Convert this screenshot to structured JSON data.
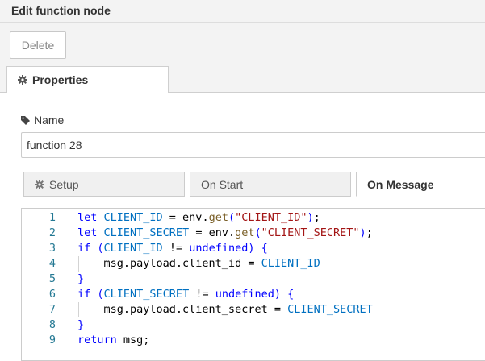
{
  "dialog": {
    "title": "Edit function node"
  },
  "toolbar": {
    "delete_label": "Delete"
  },
  "tabs": {
    "properties_label": "Properties"
  },
  "form": {
    "name_label": "Name",
    "name_value": "function 28"
  },
  "subtabs": [
    {
      "label": "Setup",
      "icon": "gear-icon",
      "active": false
    },
    {
      "label": "On Start",
      "active": false
    },
    {
      "label": "On Message",
      "active": true
    }
  ],
  "editor": {
    "lines": [
      {
        "n": "1",
        "tokens": [
          {
            "t": "let ",
            "c": "kw"
          },
          {
            "t": "CLIENT_ID",
            "c": "const"
          },
          {
            "t": " = env.",
            "c": "plain"
          },
          {
            "t": "get",
            "c": "fn"
          },
          {
            "t": "(",
            "c": "kw"
          },
          {
            "t": "\"CLIENT_ID\"",
            "c": "str"
          },
          {
            "t": ")",
            "c": "kw"
          },
          {
            "t": ";",
            "c": "plain"
          }
        ]
      },
      {
        "n": "2",
        "tokens": [
          {
            "t": "let ",
            "c": "kw"
          },
          {
            "t": "CLIENT_SECRET",
            "c": "const"
          },
          {
            "t": " = env.",
            "c": "plain"
          },
          {
            "t": "get",
            "c": "fn"
          },
          {
            "t": "(",
            "c": "kw"
          },
          {
            "t": "\"CLIENT_SECRET\"",
            "c": "str"
          },
          {
            "t": ")",
            "c": "kw"
          },
          {
            "t": ";",
            "c": "plain"
          }
        ]
      },
      {
        "n": "3",
        "tokens": [
          {
            "t": "if ",
            "c": "kw"
          },
          {
            "t": "(",
            "c": "kw"
          },
          {
            "t": "CLIENT_ID",
            "c": "const"
          },
          {
            "t": " != ",
            "c": "plain"
          },
          {
            "t": "undefined",
            "c": "kw"
          },
          {
            "t": ") {",
            "c": "kw"
          }
        ]
      },
      {
        "n": "4",
        "indent": true,
        "tokens": [
          {
            "t": "    msg.payload.client_id = ",
            "c": "plain"
          },
          {
            "t": "CLIENT_ID",
            "c": "const"
          }
        ]
      },
      {
        "n": "5",
        "tokens": [
          {
            "t": "}",
            "c": "kw"
          }
        ]
      },
      {
        "n": "6",
        "tokens": [
          {
            "t": "if ",
            "c": "kw"
          },
          {
            "t": "(",
            "c": "kw"
          },
          {
            "t": "CLIENT_SECRET",
            "c": "const"
          },
          {
            "t": " != ",
            "c": "plain"
          },
          {
            "t": "undefined",
            "c": "kw"
          },
          {
            "t": ") {",
            "c": "kw"
          }
        ]
      },
      {
        "n": "7",
        "indent": true,
        "tokens": [
          {
            "t": "    msg.payload.client_secret = ",
            "c": "plain"
          },
          {
            "t": "CLIENT_SECRET",
            "c": "const"
          }
        ]
      },
      {
        "n": "8",
        "tokens": [
          {
            "t": "}",
            "c": "kw"
          }
        ]
      },
      {
        "n": "9",
        "tokens": [
          {
            "t": "return ",
            "c": "kw"
          },
          {
            "t": "msg;",
            "c": "plain"
          }
        ]
      }
    ]
  },
  "colors": {
    "keyword": "#0000ff",
    "constant": "#0070c1",
    "string": "#a31515",
    "function": "#795e26",
    "line_number": "#237893"
  }
}
